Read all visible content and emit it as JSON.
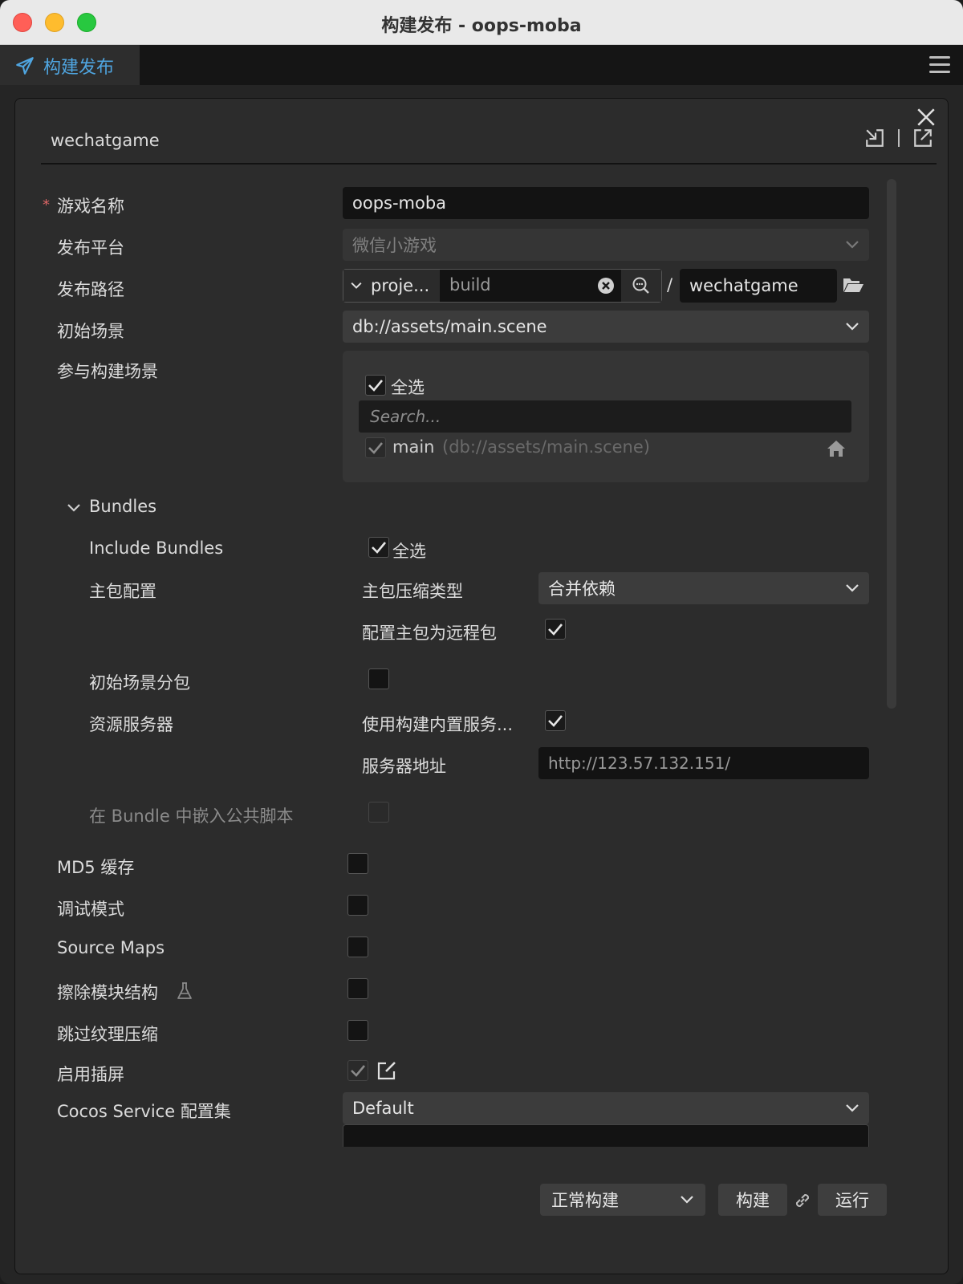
{
  "window": {
    "title": "构建发布 - oops-moba"
  },
  "tab": {
    "label": "构建发布"
  },
  "panel": {
    "platform": "wechatgame"
  },
  "form": {
    "game_name": {
      "label": "游戏名称",
      "value": "oops-moba"
    },
    "platform": {
      "label": "发布平台",
      "value": "微信小游戏"
    },
    "build_path": {
      "label": "发布路径",
      "prefix": "proje...",
      "path": "build",
      "output": "wechatgame",
      "separator": "/"
    },
    "start_scene": {
      "label": "初始场景",
      "value": "db://assets/main.scene"
    },
    "scenes": {
      "label": "参与构建场景",
      "select_all": "全选",
      "search_placeholder": "Search...",
      "item_name": "main",
      "item_path": "(db://assets/main.scene)"
    },
    "bundles": {
      "title": "Bundles",
      "include_label": "Include Bundles",
      "include_select_all": "全选",
      "main_config_label": "主包配置",
      "compress_label": "主包压缩类型",
      "compress_value": "合并依赖",
      "remote_label": "配置主包为远程包",
      "start_scene_subpkg_label": "初始场景分包",
      "server_label": "资源服务器",
      "use_builtin_server_label": "使用构建内置服务...",
      "server_address_label": "服务器地址",
      "server_address_value": "http://123.57.132.151/",
      "embed_script_label": "在 Bundle 中嵌入公共脚本"
    },
    "md5_label": "MD5 缓存",
    "debug_label": "调试模式",
    "source_maps_label": "Source Maps",
    "erase_modules_label": "擦除模块结构",
    "skip_texture_label": "跳过纹理压缩",
    "splash_label": "启用插屏",
    "cocos_service": {
      "label": "Cocos Service 配置集",
      "value": "Default"
    }
  },
  "footer": {
    "build_mode": "正常构建",
    "build_button": "构建",
    "run_button": "运行"
  },
  "colors": {
    "accent": "#4fa5e0",
    "panel_bg": "#2c2c2c",
    "input_bg": "#131313"
  }
}
